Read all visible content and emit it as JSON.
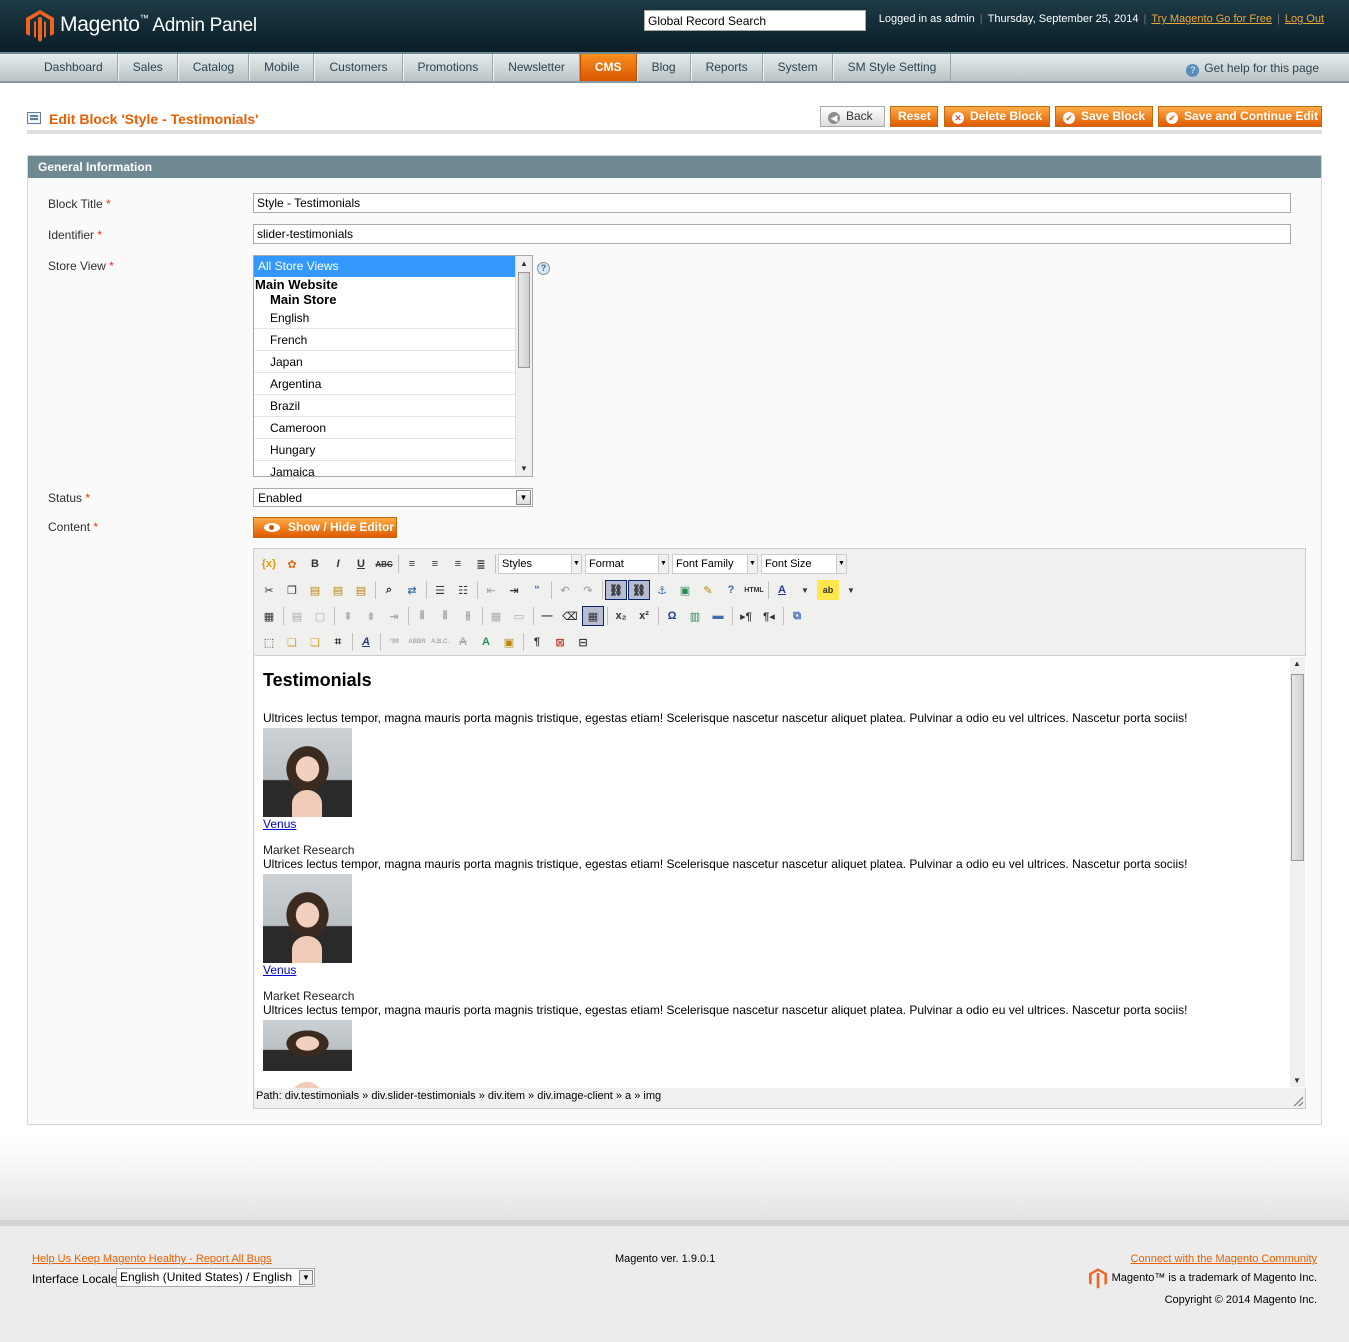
{
  "header": {
    "logo_text": "Magento",
    "logo_tm": "™",
    "logo_subtitle": "Admin Panel",
    "search_placeholder": "Global Record Search",
    "logged_in": "Logged in as admin",
    "date": "Thursday, September 25, 2014",
    "try_link": "Try Magento Go for Free",
    "logout_link": "Log Out",
    "separator": "|"
  },
  "nav": {
    "items": [
      {
        "label": "Dashboard"
      },
      {
        "label": "Sales"
      },
      {
        "label": "Catalog"
      },
      {
        "label": "Mobile"
      },
      {
        "label": "Customers"
      },
      {
        "label": "Promotions"
      },
      {
        "label": "Newsletter"
      },
      {
        "label": "CMS"
      },
      {
        "label": "Blog"
      },
      {
        "label": "Reports"
      },
      {
        "label": "System"
      },
      {
        "label": "SM Style Setting"
      }
    ],
    "active": "CMS",
    "help": "Get help for this page"
  },
  "page": {
    "title": "Edit Block 'Style - Testimonials'",
    "buttons": {
      "back": "Back",
      "reset": "Reset",
      "delete": "Delete Block",
      "save": "Save Block",
      "save_continue": "Save and Continue Edit"
    }
  },
  "form": {
    "section_title": "General Information",
    "required_mark": "*",
    "block_title_label": "Block Title",
    "block_title_value": "Style - Testimonials",
    "identifier_label": "Identifier",
    "identifier_value": "slider-testimonials",
    "store_view_label": "Store View",
    "store_views": {
      "selected": "All Store Views",
      "website": "Main Website",
      "store": "Main Store",
      "options": [
        "English",
        "French",
        "Japan",
        "Argentina",
        "Brazil",
        "Cameroon",
        "Hungary",
        "Jamaica"
      ]
    },
    "status_label": "Status",
    "status_value": "Enabled",
    "content_label": "Content",
    "show_hide_editor": "Show / Hide Editor"
  },
  "editor": {
    "toolbar": {
      "styles": "Styles",
      "format": "Format",
      "font_family": "Font Family",
      "font_size": "Font Size"
    },
    "content": {
      "heading": "Testimonials",
      "items": [
        {
          "text": "Ultrices lectus tempor, magna mauris porta magnis tristique, egestas etiam! Scelerisque nascetur nascetur aliquet platea. Pulvinar a odio eu vel ultrices. Nascetur porta sociis!",
          "name": "Venus",
          "role": "Market Research"
        },
        {
          "text": "Ultrices lectus tempor, magna mauris porta magnis tristique, egestas etiam! Scelerisque nascetur nascetur aliquet platea. Pulvinar a odio eu vel ultrices. Nascetur porta sociis!",
          "name": "Venus",
          "role": "Market Research"
        },
        {
          "text": "Ultrices lectus tempor, magna mauris porta magnis tristique, egestas etiam! Scelerisque nascetur nascetur aliquet platea. Pulvinar a odio eu vel ultrices. Nascetur porta sociis!"
        }
      ]
    },
    "path": "Path: div.testimonials » div.slider-testimonials » div.item » div.image-client » a » img"
  },
  "footer": {
    "bug_link": "Help Us Keep Magento Healthy - Report All Bugs",
    "locale_label": "Interface Locale:",
    "locale_value": "English (United States) / English",
    "version": "Magento ver. 1.9.0.1",
    "community_link": "Connect with the Magento Community",
    "trademark": "Magento™ is a trademark of Magento Inc.",
    "copyright": "Copyright © 2014 Magento Inc."
  },
  "colors": {
    "accent": "#eb5e00",
    "header_bg": "#0e2630",
    "section_header": "#6f8992",
    "selection": "#3399ff"
  }
}
